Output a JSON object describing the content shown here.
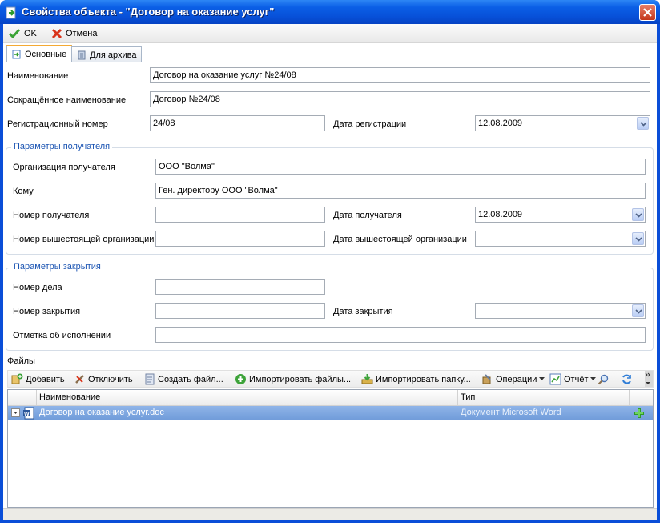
{
  "window": {
    "title": "Свойства объекта - \"Договор на оказание услуг\""
  },
  "toolbar": {
    "ok_label": "OK",
    "cancel_label": "Отмена"
  },
  "tabs": [
    {
      "label": "Основные",
      "active": true
    },
    {
      "label": "Для архива",
      "active": false
    }
  ],
  "main": {
    "name_label": "Наименование",
    "name_value": "Договор на оказание услуг №24/08",
    "short_name_label": "Сокращённое наименование",
    "short_name_value": "Договор №24/08",
    "reg_number_label": "Регистрационный номер",
    "reg_number_value": "24/08",
    "reg_date_label": "Дата регистрации",
    "reg_date_value": "12.08.2009"
  },
  "recipient": {
    "group_title": "Параметры получателя",
    "org_label": "Организация получателя",
    "org_value": "ООО \"Волма\"",
    "to_label": "Кому",
    "to_value": "Ген. директору ООО \"Волма\"",
    "number_label": "Номер получателя",
    "number_value": "",
    "date_label": "Дата получателя",
    "date_value": "12.08.2009",
    "parent_number_label": "Номер вышестоящей организации",
    "parent_number_value": "",
    "parent_date_label": "Дата вышестоящей организации",
    "parent_date_value": ""
  },
  "closing": {
    "group_title": "Параметры закрытия",
    "case_number_label": "Номер дела",
    "case_number_value": "",
    "closing_number_label": "Номер закрытия",
    "closing_number_value": "",
    "closing_date_label": "Дата закрытия",
    "closing_date_value": "",
    "execution_mark_label": "Отметка об исполнении",
    "execution_mark_value": ""
  },
  "files": {
    "section_label": "Файлы",
    "toolbar": {
      "add": "Добавить",
      "detach": "Отключить",
      "create_file": "Создать файл...",
      "import_files": "Импортировать файлы...",
      "import_folder": "Импортировать папку...",
      "operations": "Операции",
      "report": "Отчёт"
    },
    "columns": [
      "Наименование",
      "Тип"
    ],
    "rows": [
      {
        "name": "Договор на оказание услуг.doc",
        "type": "Документ Microsoft Word"
      }
    ]
  },
  "colors": {
    "title_bar": "#0b5fe6",
    "selection": "#7ba4e0",
    "group_title": "#1c55b3",
    "active_tab_accent": "#f4a933"
  }
}
